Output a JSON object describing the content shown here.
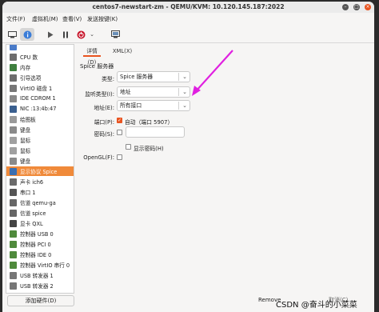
{
  "window": {
    "title": "centos7-newstart-zm - QEMU/KVM: 10.120.145.187:2022"
  },
  "menu": [
    "文件(F)",
    "虚拟机(M)",
    "查看(V)",
    "发送按键(K)"
  ],
  "toolbar": {
    "icons": [
      "monitor-icon",
      "info-icon",
      "play-icon",
      "pause-icon",
      "power-icon",
      "chevron-down-icon",
      "screenshot-icon"
    ]
  },
  "sidebar": {
    "items": [
      {
        "label": "",
        "icon": "overview-icon"
      },
      {
        "label": "CPU 数",
        "icon": "cpu-icon"
      },
      {
        "label": "内存",
        "icon": "memory-icon"
      },
      {
        "label": "引导选项",
        "icon": "boot-icon"
      },
      {
        "label": "VirtIO 磁盘 1",
        "icon": "disk-icon"
      },
      {
        "label": "IDE CDROM 1",
        "icon": "cdrom-icon"
      },
      {
        "label": "NIC :13:4b:47",
        "icon": "nic-icon"
      },
      {
        "label": "绘图板",
        "icon": "tablet-icon"
      },
      {
        "label": "键盘",
        "icon": "keyboard-icon"
      },
      {
        "label": "鼠标",
        "icon": "mouse-icon"
      },
      {
        "label": "鼠标",
        "icon": "mouse-icon"
      },
      {
        "label": "键盘",
        "icon": "keyboard-icon"
      },
      {
        "label": "显示协议 Spice",
        "icon": "display-icon"
      },
      {
        "label": "声卡 ich6",
        "icon": "sound-icon"
      },
      {
        "label": "串口 1",
        "icon": "serial-icon"
      },
      {
        "label": "信道 qemu-ga",
        "icon": "channel-icon"
      },
      {
        "label": "信道 spice",
        "icon": "channel-icon"
      },
      {
        "label": "显卡 QXL",
        "icon": "video-icon"
      },
      {
        "label": "控制器 USB 0",
        "icon": "controller-icon"
      },
      {
        "label": "控制器 PCI 0",
        "icon": "controller-icon"
      },
      {
        "label": "控制器 IDE 0",
        "icon": "controller-icon"
      },
      {
        "label": "控制器 VirtIO 串行 0",
        "icon": "controller-icon"
      },
      {
        "label": "USB 转发器 1",
        "icon": "usb-icon"
      },
      {
        "label": "USB 转发器 2",
        "icon": "usb-icon"
      }
    ],
    "selected": "显示协议 Spice",
    "add_hardware": "添加硬件(D)"
  },
  "tabs": [
    "详情(D)",
    "XML(X)"
  ],
  "form": {
    "section": "Spice 服务器",
    "type_label": "类型:",
    "type_value": "Spice 服务器",
    "listen_label": "监听类型(I):",
    "listen_value": "地址",
    "address_label": "地址(E):",
    "address_value": "所有接口",
    "port_label": "端口(P):",
    "port_auto": "自动（端口 5907）",
    "password_label": "密码(S):",
    "show_password": "显示密码(H)",
    "opengl_label": "OpenGL(F):"
  },
  "buttons": {
    "remove": "Remove",
    "cancel": "取消(C)"
  },
  "watermark": "CSDN @奋斗的小菜菜",
  "colors": {
    "accent": "#e95420",
    "selection": "#f08a3a",
    "arrow": "#e020e0"
  }
}
